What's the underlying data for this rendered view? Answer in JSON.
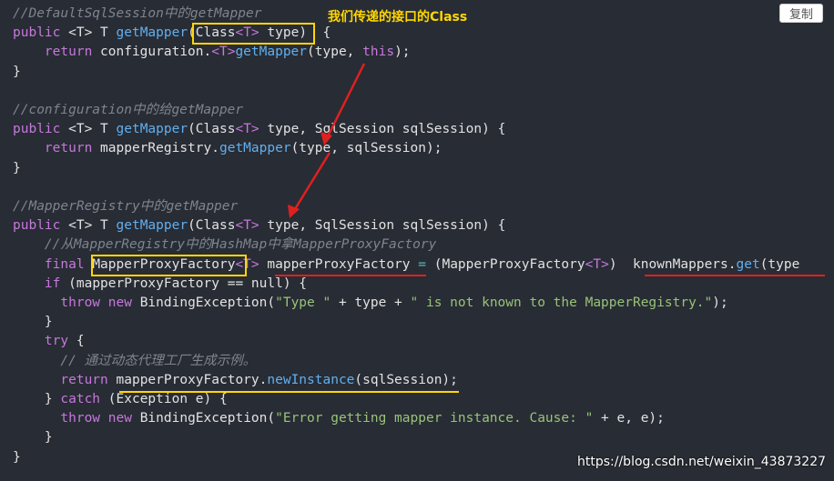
{
  "toolbar": {
    "copy_label": "复制"
  },
  "annotation": {
    "callout": "我们传递的接口的Class"
  },
  "watermark": "https://blog.csdn.net/weixin_43873227",
  "colors": {
    "highlight_box": "#ffd700",
    "underline_red": "#e02020",
    "underline_yellow": "#ffd700",
    "arrow": "#e02020"
  },
  "code": {
    "lines": [
      [
        [
          "c",
          "//DefaultSqlSession中的getMapper"
        ]
      ],
      [
        [
          "k",
          "public "
        ],
        [
          "p",
          "<T> "
        ],
        [
          "p",
          "T "
        ],
        [
          "f",
          "getMapper"
        ],
        [
          "p",
          "(Class"
        ],
        [
          "t",
          "<T>"
        ],
        [
          "p",
          " type"
        ],
        [
          "p",
          ")  {"
        ]
      ],
      [
        [
          "p",
          "    "
        ],
        [
          "k",
          "return "
        ],
        [
          "p",
          "configuration."
        ],
        [
          "t",
          "<T>"
        ],
        [
          "f",
          "getMapper"
        ],
        [
          "p",
          "(type, "
        ],
        [
          "k",
          "this"
        ],
        [
          "p",
          ");"
        ]
      ],
      [
        [
          "p",
          "}"
        ]
      ],
      [
        [
          "p",
          ""
        ]
      ],
      [
        [
          "c",
          "//configuration中的给getMapper"
        ]
      ],
      [
        [
          "k",
          "public "
        ],
        [
          "p",
          "<T> "
        ],
        [
          "p",
          "T "
        ],
        [
          "f",
          "getMapper"
        ],
        [
          "p",
          "(Class"
        ],
        [
          "t",
          "<T>"
        ],
        [
          "p",
          " type, SqlSession sqlSession) {"
        ]
      ],
      [
        [
          "p",
          "    "
        ],
        [
          "k",
          "return "
        ],
        [
          "p",
          "mapperRegistry."
        ],
        [
          "f",
          "getMapper"
        ],
        [
          "p",
          "(type, sqlSession);"
        ]
      ],
      [
        [
          "p",
          "}"
        ]
      ],
      [
        [
          "p",
          ""
        ]
      ],
      [
        [
          "c",
          "//MapperRegistry中的getMapper"
        ]
      ],
      [
        [
          "k",
          "public "
        ],
        [
          "p",
          "<T> "
        ],
        [
          "p",
          "T "
        ],
        [
          "f",
          "getMapper"
        ],
        [
          "p",
          "(Class"
        ],
        [
          "t",
          "<T>"
        ],
        [
          "p",
          " type, SqlSession sqlSession) {"
        ]
      ],
      [
        [
          "c",
          "    //从MapperRegistry中的HashMap中拿MapperProxyFactory"
        ]
      ],
      [
        [
          "p",
          "    "
        ],
        [
          "k",
          "final "
        ],
        [
          "p",
          "MapperProxyFactory"
        ],
        [
          "t",
          "<T>"
        ],
        [
          "p",
          " mapperProxyFactory "
        ],
        [
          "o",
          "="
        ],
        [
          "p",
          " (MapperProxyFactory"
        ],
        [
          "t",
          "<T>"
        ],
        [
          "p",
          ")  knownMappers."
        ],
        [
          "f",
          "get"
        ],
        [
          "p",
          "(type"
        ]
      ],
      [
        [
          "p",
          "    "
        ],
        [
          "k",
          "if "
        ],
        [
          "p",
          "(mapperProxyFactory == null) {"
        ]
      ],
      [
        [
          "p",
          "      "
        ],
        [
          "k",
          "throw new "
        ],
        [
          "p",
          "BindingException("
        ],
        [
          "s",
          "\"Type \""
        ],
        [
          "p",
          " + type + "
        ],
        [
          "s",
          "\" is not known to the MapperRegistry.\""
        ],
        [
          "p",
          ");"
        ]
      ],
      [
        [
          "p",
          "    }"
        ]
      ],
      [
        [
          "p",
          "    "
        ],
        [
          "k",
          "try "
        ],
        [
          "p",
          "{"
        ]
      ],
      [
        [
          "c",
          "      // 通过动态代理工厂生成示例。"
        ]
      ],
      [
        [
          "p",
          "      "
        ],
        [
          "k",
          "return "
        ],
        [
          "p",
          "mapperProxyFactory."
        ],
        [
          "f",
          "newInstance"
        ],
        [
          "p",
          "(sqlSession);"
        ]
      ],
      [
        [
          "p",
          "    } "
        ],
        [
          "k",
          "catch "
        ],
        [
          "p",
          "(Exception e) {"
        ]
      ],
      [
        [
          "p",
          "      "
        ],
        [
          "k",
          "throw new "
        ],
        [
          "p",
          "BindingException("
        ],
        [
          "s",
          "\"Error getting mapper instance. Cause: \""
        ],
        [
          "p",
          " + e, e);"
        ]
      ],
      [
        [
          "p",
          "    }"
        ]
      ],
      [
        [
          "p",
          "}"
        ]
      ]
    ]
  }
}
